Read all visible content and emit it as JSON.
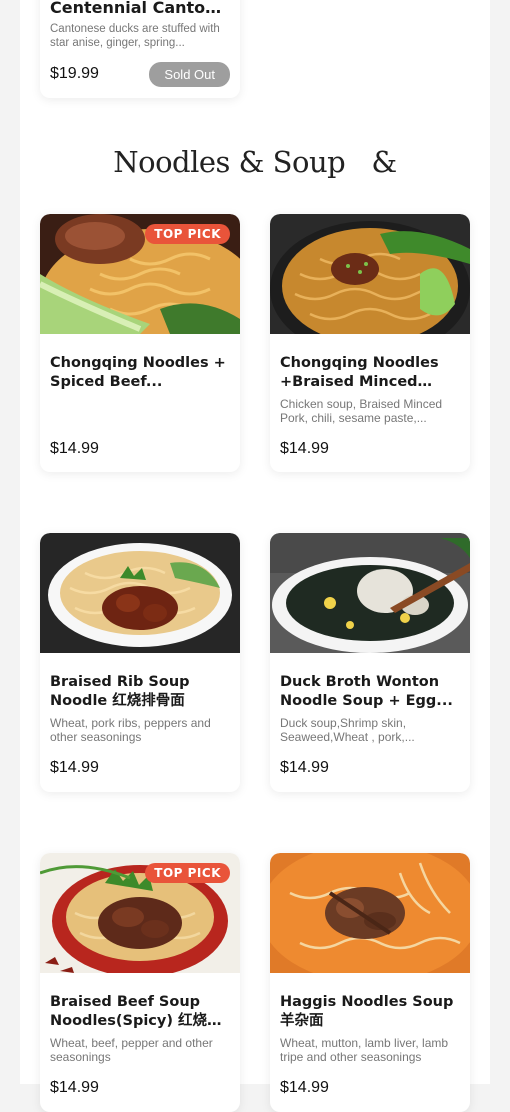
{
  "top_card": {
    "name": "Centennial Cantones...",
    "description": "Cantonese ducks are stuffed with star anise, ginger, spring...",
    "price": "$19.99",
    "status": "Sold Out"
  },
  "section": {
    "title": "Noodles & Soup",
    "title_suffix": "&"
  },
  "badge_label": "TOP PICK",
  "items": [
    {
      "name": "Chongqing Noodles + Spiced Beef...",
      "description": "",
      "price": "$14.99",
      "top_pick": true,
      "image_icon": "noodles-beef-image"
    },
    {
      "name": "Chongqing Noodles +Braised Minced Pork...",
      "description": "Chicken soup, Braised Minced Pork, chili, sesame paste,...",
      "price": "$14.99",
      "top_pick": false,
      "image_icon": "noodles-minced-pork-image"
    },
    {
      "name": "Braised Rib Soup Noodle 红烧排骨面",
      "description": "Wheat, pork ribs, peppers and other seasonings",
      "price": "$14.99",
      "top_pick": false,
      "image_icon": "rib-soup-noodle-image"
    },
    {
      "name": "Duck Broth Wonton Noodle Soup + Egg...",
      "description": "Duck soup,Shrimp skin, Seaweed,Wheat , pork,...",
      "price": "$14.99",
      "top_pick": false,
      "image_icon": "wonton-soup-image"
    },
    {
      "name": "Braised Beef Soup Noodles(Spicy) 红烧牛肉面",
      "description": "Wheat, beef, pepper and other seasonings",
      "price": "$14.99",
      "top_pick": true,
      "image_icon": "beef-soup-noodle-image"
    },
    {
      "name": "Haggis Noodles Soup 羊杂面",
      "description": "Wheat, mutton, lamb liver, lamb tripe and other seasonings",
      "price": "$14.99",
      "top_pick": false,
      "image_icon": "haggis-noodle-image"
    }
  ],
  "colors": {
    "badge": "#e9543a",
    "sold_out": "#9e9e9e",
    "background": "#f3f3f3"
  }
}
